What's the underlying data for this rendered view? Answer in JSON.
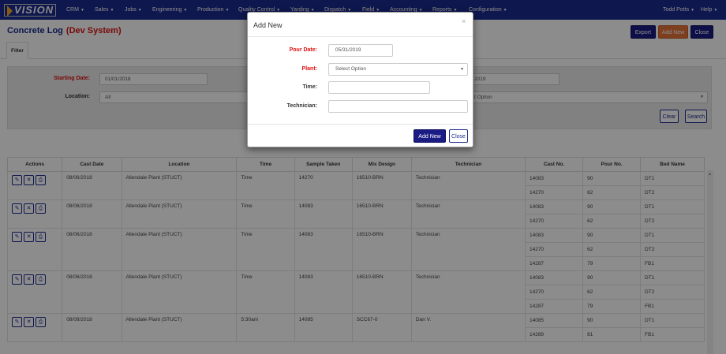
{
  "nav": {
    "logo": "VISION",
    "menus": [
      "CRM",
      "Sales",
      "Jobs",
      "Engineering",
      "Production",
      "Quality Control",
      "Yarding",
      "Dispatch",
      "Field",
      "Accounting",
      "Reports",
      "Configuration"
    ],
    "user": "Todd Potts",
    "help": "Help"
  },
  "page": {
    "title": "Concrete Log",
    "env": "(Dev System)",
    "export": "Export",
    "add_new": "Add New",
    "close": "Close"
  },
  "colors": {
    "navy": "#1b2a8e",
    "orange": "#e6743a",
    "required": "#dd1111"
  },
  "filter": {
    "tab": "Filter",
    "starting_date_label": "Starting Date:",
    "starting_date": "01/01/2018",
    "ending_date_visible": "2019",
    "location_label": "Location:",
    "location": "All",
    "option_visible": "t Option",
    "clear": "Clear",
    "search": "Search"
  },
  "table": {
    "headers": [
      "Actions",
      "Cast Date",
      "Location",
      "Time",
      "Sample Taken",
      "Mix Design",
      "Technician",
      "Cast No.",
      "Pour No.",
      "Bed Name"
    ],
    "rows": [
      {
        "cast_date": "08/06/2018",
        "location": "Allendale Plant (STUCT)",
        "time": "Time",
        "sample": "14270",
        "mix": "16510-BRN",
        "tech": "Technician",
        "subs": [
          {
            "cast_no": "14083",
            "pour_no": "90",
            "bed": "DT1"
          },
          {
            "cast_no": "14270",
            "pour_no": "62",
            "bed": "DT2"
          }
        ]
      },
      {
        "cast_date": "08/06/2018",
        "location": "Allendale Plant (STUCT)",
        "time": "Time",
        "sample": "14083",
        "mix": "16510-BRN",
        "tech": "Technician",
        "subs": [
          {
            "cast_no": "14083",
            "pour_no": "90",
            "bed": "DT1"
          },
          {
            "cast_no": "14270",
            "pour_no": "62",
            "bed": "DT2"
          }
        ]
      },
      {
        "cast_date": "08/06/2018",
        "location": "Allendale Plant (STUCT)",
        "time": "Time",
        "sample": "14083",
        "mix": "16510-BRN",
        "tech": "Technician",
        "subs": [
          {
            "cast_no": "14083",
            "pour_no": "90",
            "bed": "DT1"
          },
          {
            "cast_no": "14270",
            "pour_no": "62",
            "bed": "DT2"
          },
          {
            "cast_no": "14287",
            "pour_no": "79",
            "bed": "FB1"
          }
        ]
      },
      {
        "cast_date": "08/06/2018",
        "location": "Allendale Plant (STUCT)",
        "time": "Time",
        "sample": "14083",
        "mix": "16510-BRN",
        "tech": "Technician",
        "subs": [
          {
            "cast_no": "14083",
            "pour_no": "90",
            "bed": "DT1"
          },
          {
            "cast_no": "14270",
            "pour_no": "62",
            "bed": "DT2"
          },
          {
            "cast_no": "14287",
            "pour_no": "79",
            "bed": "FB1"
          }
        ]
      },
      {
        "cast_date": "08/08/2018",
        "location": "Allendale Plant (STUCT)",
        "time": "5:30am",
        "sample": "14085",
        "mix": "SCC67-0",
        "tech": "Dan V.",
        "subs": [
          {
            "cast_no": "14085",
            "pour_no": "90",
            "bed": "DT1"
          },
          {
            "cast_no": "14289",
            "pour_no": "81",
            "bed": "FB1"
          }
        ]
      }
    ]
  },
  "modal": {
    "title": "Add New",
    "close_x": "×",
    "pour_date_label": "Pour Date:",
    "pour_date": "05/31/2019",
    "plant_label": "Plant:",
    "plant": "Select Option",
    "time_label": "Time:",
    "time": "",
    "technician_label": "Technician:",
    "technician": "",
    "add_new": "Add New",
    "close": "Close"
  }
}
